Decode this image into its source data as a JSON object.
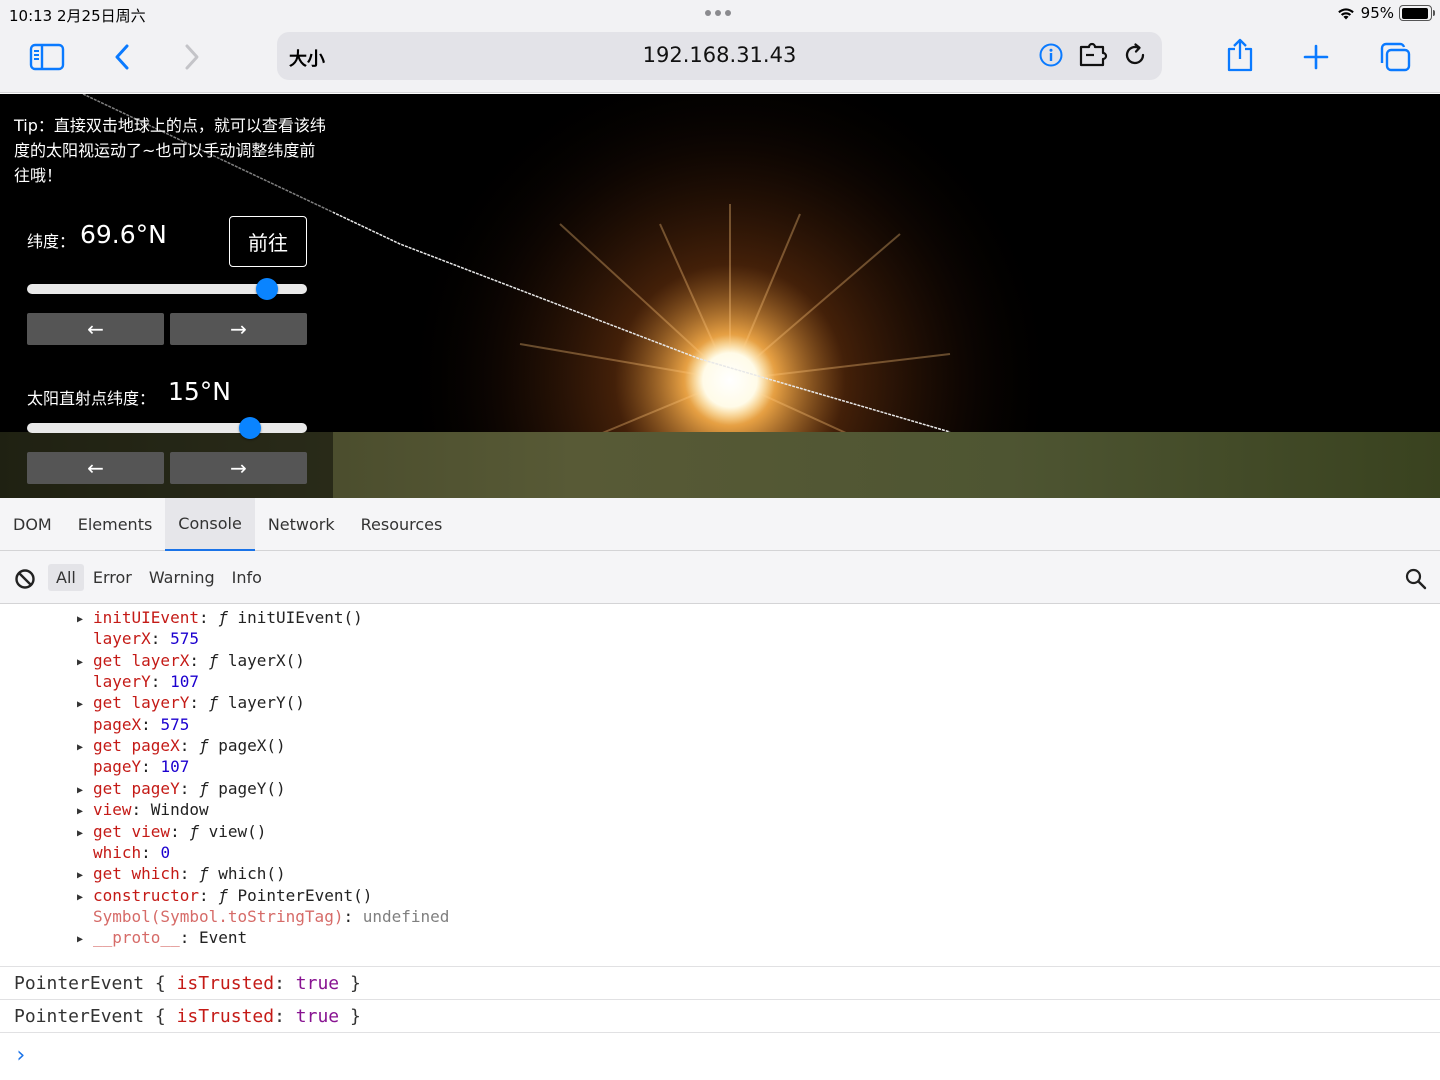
{
  "status_bar": {
    "time_date": "10:13  2月25日周六",
    "battery": "95%",
    "battery_level": 0.95
  },
  "toolbar": {
    "size_label": "大小",
    "url": "192.168.31.43"
  },
  "webpage": {
    "tip": "Tip：直接双击地球上的点，就可以查看该纬度的太阳视运动了~也可以手动调整纬度前往哦！",
    "latitude_label": "纬度：",
    "latitude_value": "69.6°N",
    "latitude_slider_fraction": 0.857,
    "go_button": "前往",
    "sun_label": "太阳直射点纬度：",
    "sun_value": "15°N",
    "sun_slider_fraction": 0.797,
    "prev_arrow": "←",
    "next_arrow": "→"
  },
  "devtools": {
    "tabs": [
      "DOM",
      "Elements",
      "Console",
      "Network",
      "Resources"
    ],
    "active_tab": "Console",
    "filters": [
      "All",
      "Error",
      "Warning",
      "Info"
    ],
    "active_filter": "All"
  },
  "console": {
    "tree": [
      {
        "arrow": true,
        "key": "initUIEvent",
        "sep": ": ",
        "fn": "ƒ",
        "value": " initUIEvent()"
      },
      {
        "arrow": false,
        "key": "layerX",
        "sep": ": ",
        "num": "575"
      },
      {
        "arrow": true,
        "key": "get layerX",
        "sep": ": ",
        "fn": "ƒ",
        "value": " layerX()"
      },
      {
        "arrow": false,
        "key": "layerY",
        "sep": ": ",
        "num": "107"
      },
      {
        "arrow": true,
        "key": "get layerY",
        "sep": ": ",
        "fn": "ƒ",
        "value": " layerY()"
      },
      {
        "arrow": false,
        "key": "pageX",
        "sep": ": ",
        "num": "575"
      },
      {
        "arrow": true,
        "key": "get pageX",
        "sep": ": ",
        "fn": "ƒ",
        "value": " pageX()"
      },
      {
        "arrow": false,
        "key": "pageY",
        "sep": ": ",
        "num": "107"
      },
      {
        "arrow": true,
        "key": "get pageY",
        "sep": ": ",
        "fn": "ƒ",
        "value": " pageY()"
      },
      {
        "arrow": true,
        "key": "view",
        "sep": ": ",
        "value": "Window"
      },
      {
        "arrow": true,
        "key": "get view",
        "sep": ": ",
        "fn": "ƒ",
        "value": " view()"
      },
      {
        "arrow": false,
        "key": "which",
        "sep": ": ",
        "num": "0"
      },
      {
        "arrow": true,
        "key": "get which",
        "sep": ": ",
        "fn": "ƒ",
        "value": " which()"
      },
      {
        "arrow": true,
        "key": "constructor",
        "sep": ": ",
        "fn": "ƒ",
        "value": " PointerEvent()"
      },
      {
        "arrow": false,
        "key": "Symbol(Symbol.toStringTag)",
        "dim": true,
        "sep": ": ",
        "gray": "undefined"
      },
      {
        "arrow": true,
        "key": "__proto__",
        "dim": true,
        "sep": ": ",
        "value": "Event"
      }
    ],
    "logs": [
      {
        "prefix": "PointerEvent { ",
        "key": "isTrusted",
        "sep": ": ",
        "value": "true",
        "suffix": " }"
      },
      {
        "prefix": "PointerEvent { ",
        "key": "isTrusted",
        "sep": ": ",
        "value": "true",
        "suffix": " }"
      }
    ],
    "prompt": "›"
  }
}
